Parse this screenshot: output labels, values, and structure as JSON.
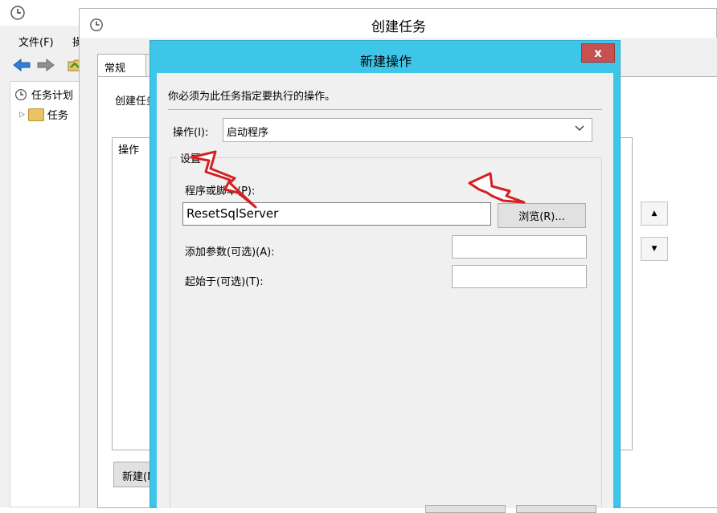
{
  "scheduler": {
    "menu": {
      "file": "文件(F)",
      "action": "操"
    },
    "tree": {
      "item1": "任务计划",
      "item2": "任务"
    }
  },
  "create_task": {
    "title": "创建任务",
    "tab_general": "常规",
    "description": "创建任务",
    "list_column_action": "操作",
    "new_button": "新建(N)..."
  },
  "new_action": {
    "title": "新建操作",
    "close_glyph": "x",
    "instruction": "你必须为此任务指定要执行的操作。",
    "action_label": "操作(I):",
    "action_value": "启动程序",
    "settings_group": "设置",
    "program_label": "程序或脚本(P):",
    "program_value": "ResetSqlServer",
    "browse_button": "浏览(R)...",
    "args_label": "添加参数(可选)(A):",
    "args_value": "",
    "start_label": "起始于(可选)(T):",
    "start_value": ""
  },
  "colors": {
    "dialog_frame": "#3ec6e8",
    "close_button": "#c75050",
    "annotation_arrow": "#d32020"
  }
}
